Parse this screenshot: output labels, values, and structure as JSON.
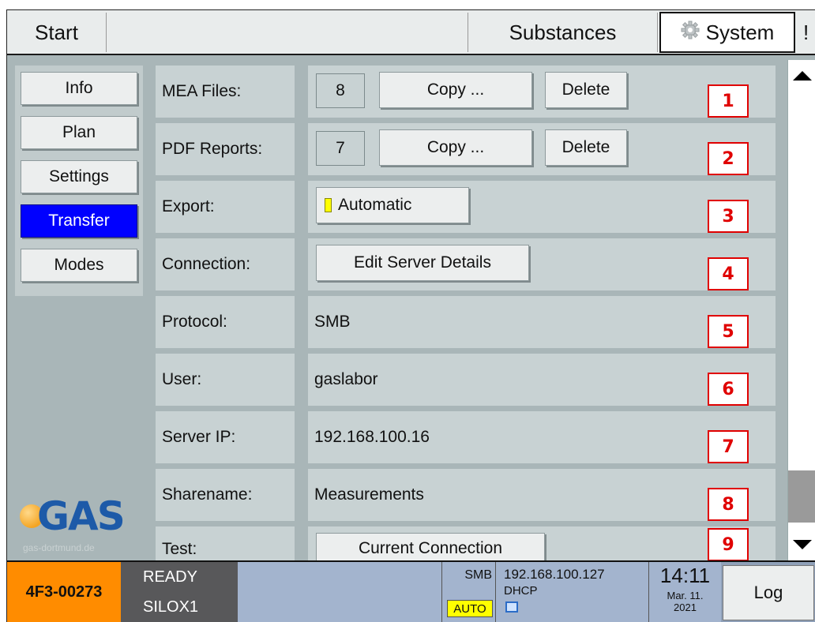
{
  "topbar": {
    "start": "Start",
    "substances": "Substances",
    "system": "System",
    "overflow": "!"
  },
  "sidebar": {
    "items": [
      {
        "label": "Info",
        "active": false
      },
      {
        "label": "Plan",
        "active": false
      },
      {
        "label": "Settings",
        "active": false
      },
      {
        "label": "Transfer",
        "active": true
      },
      {
        "label": "Modes",
        "active": false
      }
    ],
    "logo_text": "GAS",
    "logo_sub": "gas-dortmund.de"
  },
  "rows": {
    "mea": {
      "label": "MEA Files:",
      "count": "8",
      "copy": "Copy ...",
      "delete": "Delete",
      "marker": "1"
    },
    "pdf": {
      "label": "PDF Reports:",
      "count": "7",
      "copy": "Copy ...",
      "delete": "Delete",
      "marker": "2"
    },
    "export": {
      "label": "Export:",
      "toggle": "Automatic",
      "marker": "3"
    },
    "connection": {
      "label": "Connection:",
      "button": "Edit Server Details",
      "marker": "4"
    },
    "protocol": {
      "label": "Protocol:",
      "value": "SMB",
      "marker": "5"
    },
    "user": {
      "label": "User:",
      "value": "gaslabor",
      "marker": "6"
    },
    "server_ip": {
      "label": "Server IP:",
      "value": "192.168.100.16",
      "marker": "7"
    },
    "sharename": {
      "label": "Sharename:",
      "value": "Measurements",
      "marker": "8"
    },
    "test": {
      "label": "Test:",
      "button": "Current Connection",
      "marker": "9"
    }
  },
  "statusbar": {
    "device": "4F3-00273",
    "state1": "READY",
    "state2": "SILOX1",
    "protocol": "SMB",
    "auto": "AUTO",
    "ip": "192.168.100.127",
    "dhcp": "DHCP",
    "time": "14:11",
    "date1": "Mar. 11.",
    "date2": "2021",
    "log": "Log"
  },
  "colors": {
    "active_nav": "#0000ff",
    "device_badge": "#ff8c00",
    "auto_badge": "#ffff00",
    "marker_red": "#e00000"
  },
  "icons": {
    "system": "gear-icon",
    "scroll_up": "triangle-up-icon",
    "scroll_down": "triangle-down-icon",
    "network": "network-icon"
  }
}
